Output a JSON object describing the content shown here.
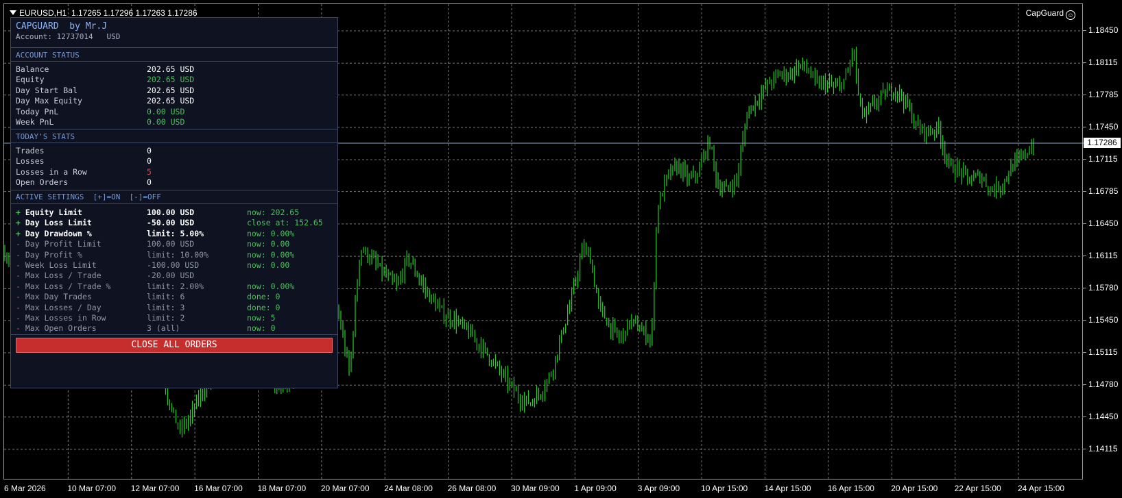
{
  "header": {
    "symbol": "EURUSD,H1",
    "ohlc": "1.17265 1.17296 1.17263 1.17286",
    "brand": "CapGuard",
    "brand_icon": "smiley-icon"
  },
  "colors": {
    "background": "#000000",
    "grid": "#7a7a7a",
    "candles": "#1fd21f",
    "panel_bg": "#0f1220",
    "panel_border": "#3b4866",
    "accent_blue": "#8ab6ff",
    "positive": "#47c45a",
    "negative": "#e04848",
    "button": "#c62d2d"
  },
  "chart_data": {
    "type": "candlestick",
    "current_price": "1.17286",
    "price_ticks": [
      "1.18450",
      "1.18115",
      "1.17785",
      "1.17450",
      "1.17115",
      "1.16785",
      "1.16450",
      "1.16115",
      "1.15780",
      "1.15450",
      "1.15115",
      "1.14780",
      "1.14450",
      "1.14115"
    ],
    "time_ticks": [
      "6 Mar 2026",
      "10 Mar 07:00",
      "12 Mar 07:00",
      "16 Mar 07:00",
      "18 Mar 07:00",
      "20 Mar 07:00",
      "24 Mar 08:00",
      "26 Mar 08:00",
      "30 Mar 09:00",
      "1 Apr 09:00",
      "3 Apr 09:00",
      "10 Apr 15:00",
      "14 Apr 15:00",
      "16 Apr 15:00",
      "20 Apr 15:00",
      "22 Apr 15:00",
      "24 Apr 15:00"
    ],
    "ylim": [
      1.14115,
      1.1845
    ],
    "grid": true,
    "close_path": [
      [
        0,
        1.1615
      ],
      [
        0.01,
        1.16
      ],
      [
        0.04,
        1.161
      ],
      [
        0.07,
        1.159
      ],
      [
        0.1,
        1.157
      ],
      [
        0.12,
        1.1555
      ],
      [
        0.145,
        1.151
      ],
      [
        0.155,
        1.146
      ],
      [
        0.165,
        1.143
      ],
      [
        0.175,
        1.1445
      ],
      [
        0.185,
        1.147
      ],
      [
        0.2,
        1.149
      ],
      [
        0.21,
        1.15
      ],
      [
        0.225,
        1.153
      ],
      [
        0.24,
        1.151
      ],
      [
        0.255,
        1.148
      ],
      [
        0.265,
        1.147
      ],
      [
        0.275,
        1.149
      ],
      [
        0.29,
        1.156
      ],
      [
        0.305,
        1.157
      ],
      [
        0.315,
        1.155
      ],
      [
        0.325,
        1.149
      ],
      [
        0.335,
        1.162
      ],
      [
        0.345,
        1.161
      ],
      [
        0.36,
        1.159
      ],
      [
        0.37,
        1.158
      ],
      [
        0.38,
        1.161
      ],
      [
        0.39,
        1.159
      ],
      [
        0.4,
        1.157
      ],
      [
        0.415,
        1.155
      ],
      [
        0.425,
        1.1545
      ],
      [
        0.44,
        1.153
      ],
      [
        0.455,
        1.151
      ],
      [
        0.465,
        1.1495
      ],
      [
        0.475,
        1.148
      ],
      [
        0.485,
        1.1465
      ],
      [
        0.495,
        1.146
      ],
      [
        0.505,
        1.147
      ],
      [
        0.515,
        1.149
      ],
      [
        0.525,
        1.153
      ],
      [
        0.535,
        1.157
      ],
      [
        0.545,
        1.162
      ],
      [
        0.552,
        1.161
      ],
      [
        0.56,
        1.156
      ],
      [
        0.57,
        1.154
      ],
      [
        0.58,
        1.1525
      ],
      [
        0.59,
        1.1545
      ],
      [
        0.6,
        1.1535
      ],
      [
        0.61,
        1.1525
      ],
      [
        0.615,
        1.166
      ],
      [
        0.625,
        1.1695
      ],
      [
        0.635,
        1.1705
      ],
      [
        0.645,
        1.169
      ],
      [
        0.655,
        1.17
      ],
      [
        0.66,
        1.172
      ],
      [
        0.665,
        1.173
      ],
      [
        0.672,
        1.1685
      ],
      [
        0.68,
        1.168
      ],
      [
        0.69,
        1.169
      ],
      [
        0.7,
        1.176
      ],
      [
        0.71,
        1.1775
      ],
      [
        0.72,
        1.179
      ],
      [
        0.73,
        1.18
      ],
      [
        0.74,
        1.18
      ],
      [
        0.75,
        1.181
      ],
      [
        0.757,
        1.1805
      ],
      [
        0.765,
        1.179
      ],
      [
        0.775,
        1.179
      ],
      [
        0.785,
        1.1785
      ],
      [
        0.795,
        1.18
      ],
      [
        0.8,
        1.183
      ],
      [
        0.805,
        1.1775
      ],
      [
        0.81,
        1.1755
      ],
      [
        0.82,
        1.177
      ],
      [
        0.83,
        1.178
      ],
      [
        0.84,
        1.1785
      ],
      [
        0.85,
        1.177
      ],
      [
        0.86,
        1.1745
      ],
      [
        0.87,
        1.174
      ],
      [
        0.88,
        1.1745
      ],
      [
        0.89,
        1.1705
      ],
      [
        0.9,
        1.17
      ],
      [
        0.91,
        1.169
      ],
      [
        0.92,
        1.1695
      ],
      [
        0.93,
        1.168
      ],
      [
        0.94,
        1.1685
      ],
      [
        0.95,
        1.1705
      ],
      [
        0.96,
        1.1715
      ],
      [
        0.97,
        1.1728
      ]
    ]
  },
  "panel": {
    "title": "CAPGUARD  by Mr.J",
    "account": "Account: 12737014   USD",
    "account_status": {
      "heading": "ACCOUNT STATUS",
      "rows": [
        {
          "label": "Balance",
          "value": "202.65 USD",
          "tone": "white"
        },
        {
          "label": "Equity",
          "value": "202.65 USD",
          "tone": "green"
        },
        {
          "label": "Day Start Bal",
          "value": "202.65 USD",
          "tone": "white"
        },
        {
          "label": "Day Max Equity",
          "value": "202.65 USD",
          "tone": "white"
        },
        {
          "label": "Today PnL",
          "value": "0.00 USD",
          "tone": "green"
        },
        {
          "label": "Week PnL",
          "value": "0.00 USD",
          "tone": "green"
        }
      ]
    },
    "todays_stats": {
      "heading": "TODAY'S STATS",
      "rows": [
        {
          "label": "Trades",
          "value": "0",
          "tone": "white"
        },
        {
          "label": "Losses",
          "value": "0",
          "tone": "white"
        },
        {
          "label": "Losses in a Row",
          "value": "5",
          "tone": "red"
        },
        {
          "label": "Open Orders",
          "value": "0",
          "tone": "white"
        }
      ]
    },
    "active_settings": {
      "heading": "ACTIVE SETTINGS  [+]=ON  [-]=OFF",
      "rows": [
        {
          "mark": "+",
          "on": true,
          "label": "Equity Limit",
          "value": "100.00 USD",
          "now": "now: 202.65"
        },
        {
          "mark": "+",
          "on": true,
          "label": "Day Loss Limit",
          "value": "-50.00 USD",
          "now": "close at: 152.65"
        },
        {
          "mark": "+",
          "on": true,
          "label": "Day Drawdown %",
          "value": "limit: 5.00%",
          "now": "now: 0.00%"
        },
        {
          "mark": "-",
          "on": false,
          "label": "Day Profit Limit",
          "value": "100.00 USD",
          "now": "now: 0.00"
        },
        {
          "mark": "-",
          "on": false,
          "label": "Day Profit %",
          "value": "limit: 10.00%",
          "now": "now: 0.00%"
        },
        {
          "mark": "-",
          "on": false,
          "label": "Week Loss Limit",
          "value": "-100.00 USD",
          "now": "now: 0.00"
        },
        {
          "mark": "-",
          "on": false,
          "label": "Max Loss / Trade",
          "value": "-20.00 USD",
          "now": ""
        },
        {
          "mark": "-",
          "on": false,
          "label": "Max Loss / Trade %",
          "value": "limit: 2.00%",
          "now": "now: 0.00%"
        },
        {
          "mark": "-",
          "on": false,
          "label": "Max Day Trades",
          "value": "limit: 6",
          "now": "done: 0"
        },
        {
          "mark": "-",
          "on": false,
          "label": "Max Losses / Day",
          "value": "limit: 3",
          "now": "done: 0"
        },
        {
          "mark": "-",
          "on": false,
          "label": "Max Losses in Row",
          "value": "limit: 2",
          "now": "now: 5"
        },
        {
          "mark": "-",
          "on": false,
          "label": "Max Open Orders",
          "value": "3 (all)",
          "now": "now: 0"
        }
      ]
    },
    "close_button_label": "CLOSE ALL ORDERS"
  }
}
